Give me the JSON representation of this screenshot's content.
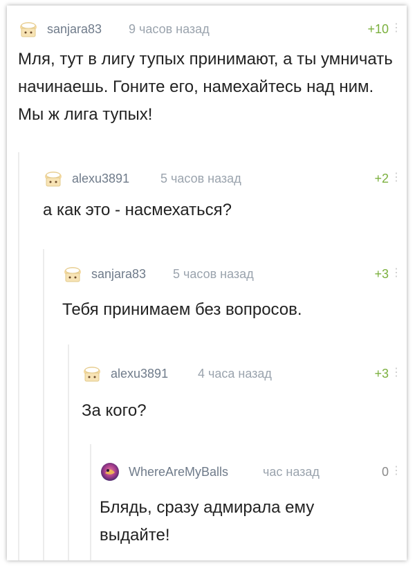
{
  "comments": [
    {
      "username": "sanjara83",
      "time": "9 часов назад",
      "rating": "+10",
      "more": "⋮",
      "avatar": "avatar-sanjara83",
      "text": "Мля, тут в лигу тупых принимают, а ты умничать начинаешь. Гоните его, намехайтесь над ним. Мы ж лига тупых!"
    },
    {
      "username": "alexu3891",
      "time": "5 часов назад",
      "rating": "+2",
      "more": "⋮",
      "avatar": "avatar-alexu3891",
      "text": "а как это - насмехаться?"
    },
    {
      "username": "sanjara83",
      "time": "5 часов назад",
      "rating": "+3",
      "more": "⋮",
      "avatar": "avatar-sanjara83",
      "text": "Тебя принимаем без вопросов."
    },
    {
      "username": "alexu3891",
      "time": "4 часа назад",
      "rating": "+3",
      "more": "⋮",
      "avatar": "avatar-alexu3891",
      "text": "За кого?"
    },
    {
      "username": "WhereAreMyBalls",
      "time": "час назад",
      "rating": "0",
      "more": "⋮",
      "avatar": "avatar-wherearemyballs",
      "text": "Блядь, сразу адмирала ему выдайте!"
    }
  ],
  "colors": {
    "positive_rating": "#7bb03e",
    "username": "#6f7b8a",
    "time": "#9aa3ad",
    "text": "#222222"
  }
}
